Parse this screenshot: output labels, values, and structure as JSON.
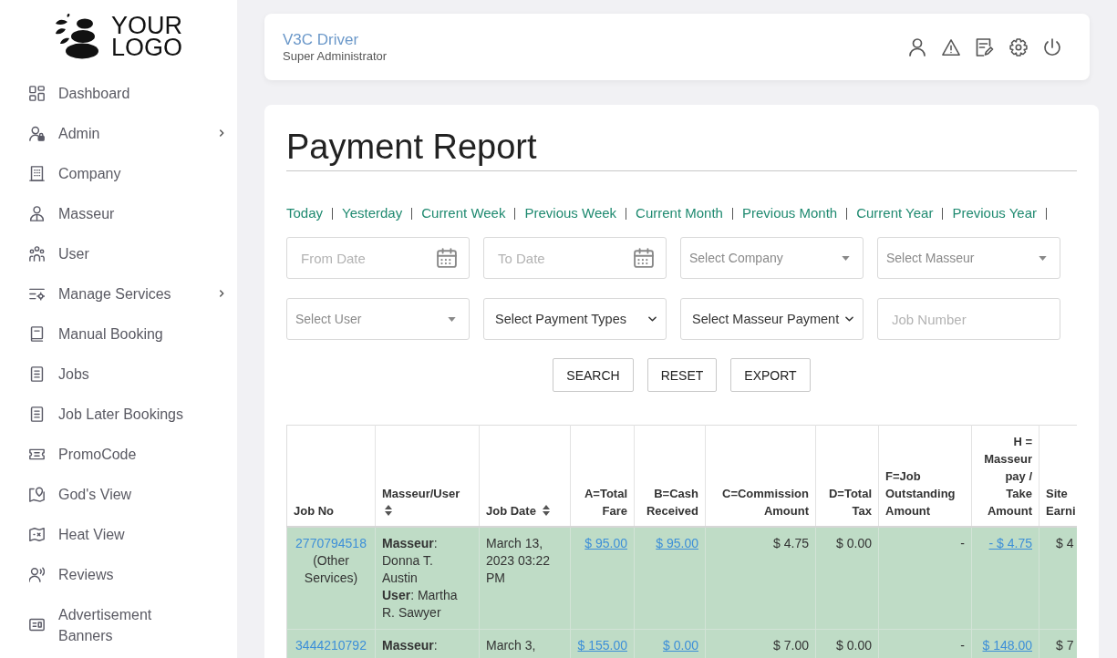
{
  "logo": {
    "lines": [
      "YOUR",
      "LOGO"
    ]
  },
  "sidebar": {
    "items": [
      {
        "label": "Dashboard",
        "expandable": false
      },
      {
        "label": "Admin",
        "expandable": true
      },
      {
        "label": "Company",
        "expandable": false
      },
      {
        "label": "Masseur",
        "expandable": false
      },
      {
        "label": "User",
        "expandable": false
      },
      {
        "label": "Manage Services",
        "expandable": true
      },
      {
        "label": "Manual Booking",
        "expandable": false
      },
      {
        "label": "Jobs",
        "expandable": false
      },
      {
        "label": "Job Later Bookings",
        "expandable": false
      },
      {
        "label": "PromoCode",
        "expandable": false
      },
      {
        "label": "God's View",
        "expandable": false
      },
      {
        "label": "Heat View",
        "expandable": false
      },
      {
        "label": "Reviews",
        "expandable": false
      },
      {
        "label": "Advertisement Banners",
        "expandable": false
      }
    ]
  },
  "header": {
    "user_name": "V3C Driver",
    "role": "Super Administrator"
  },
  "report": {
    "title": "Payment Report",
    "quick_filters": [
      "Today",
      "Yesterday",
      "Current Week",
      "Previous Week",
      "Current Month",
      "Previous Month",
      "Current Year",
      "Previous Year"
    ],
    "filters": [
      {
        "kind": "date",
        "placeholder": "From Date"
      },
      {
        "kind": "date",
        "placeholder": "To Date"
      },
      {
        "kind": "dropdown",
        "placeholder": "Select Company"
      },
      {
        "kind": "dropdown",
        "placeholder": "Select Masseur"
      },
      {
        "kind": "dropdown",
        "placeholder": "Select User"
      },
      {
        "kind": "select",
        "value": "Select Payment Types"
      },
      {
        "kind": "select",
        "value": "Select Masseur Payment"
      },
      {
        "kind": "text",
        "placeholder": "Job Number"
      }
    ],
    "buttons": [
      "SEARCH",
      "RESET",
      "EXPORT"
    ]
  },
  "table": {
    "columns": [
      {
        "label": "Job No",
        "sortable": false
      },
      {
        "label": "Masseur/User",
        "sortable": true
      },
      {
        "label": "Job Date",
        "sortable": true
      },
      {
        "label": "A=Total Fare",
        "sortable": false
      },
      {
        "label": "B=Cash Received",
        "sortable": false
      },
      {
        "label": "C=Commission Amount",
        "sortable": false
      },
      {
        "label": "D=Total Tax",
        "sortable": false
      },
      {
        "label": "F=Job Outstanding Amount",
        "sortable": false
      },
      {
        "label": "H = Masseur pay / Take Amount",
        "sortable": false
      },
      {
        "label": "Site Earni",
        "sortable": false
      }
    ],
    "rows": [
      {
        "job_no": "2770794518",
        "service": "(Other Services)",
        "masseur": "**Masseur**: Donna T. Austin",
        "user": "**User**: Martha R. Sawyer",
        "date": "March 13, 2023 03:22 PM",
        "highlighted": true,
        "amounts": [
          {
            "text": "$ 95.00",
            "kind": "link"
          },
          {
            "text": "$ 95.00",
            "kind": "link"
          },
          {
            "text": "$ 4.75",
            "kind": "text"
          },
          {
            "text": "$ 0.00",
            "kind": "text"
          },
          {
            "text": "-",
            "kind": "text"
          },
          {
            "text": "- $ 4.75",
            "kind": "link"
          },
          {
            "text": "$ 4",
            "kind": "text"
          }
        ]
      },
      {
        "job_no": "3444210792",
        "masseur": "**Masseur**:",
        "date": "March 3,",
        "highlighted": true,
        "amounts": [
          {
            "text": "$ 155.00",
            "kind": "link"
          },
          {
            "text": "$ 0.00",
            "kind": "link"
          },
          {
            "text": "$ 7.00",
            "kind": "text"
          },
          {
            "text": "$ 0.00",
            "kind": "text"
          },
          {
            "text": "-",
            "kind": "text"
          },
          {
            "text": "$ 148.00",
            "kind": "link"
          },
          {
            "text": "$ 7",
            "kind": "text"
          }
        ]
      }
    ]
  }
}
